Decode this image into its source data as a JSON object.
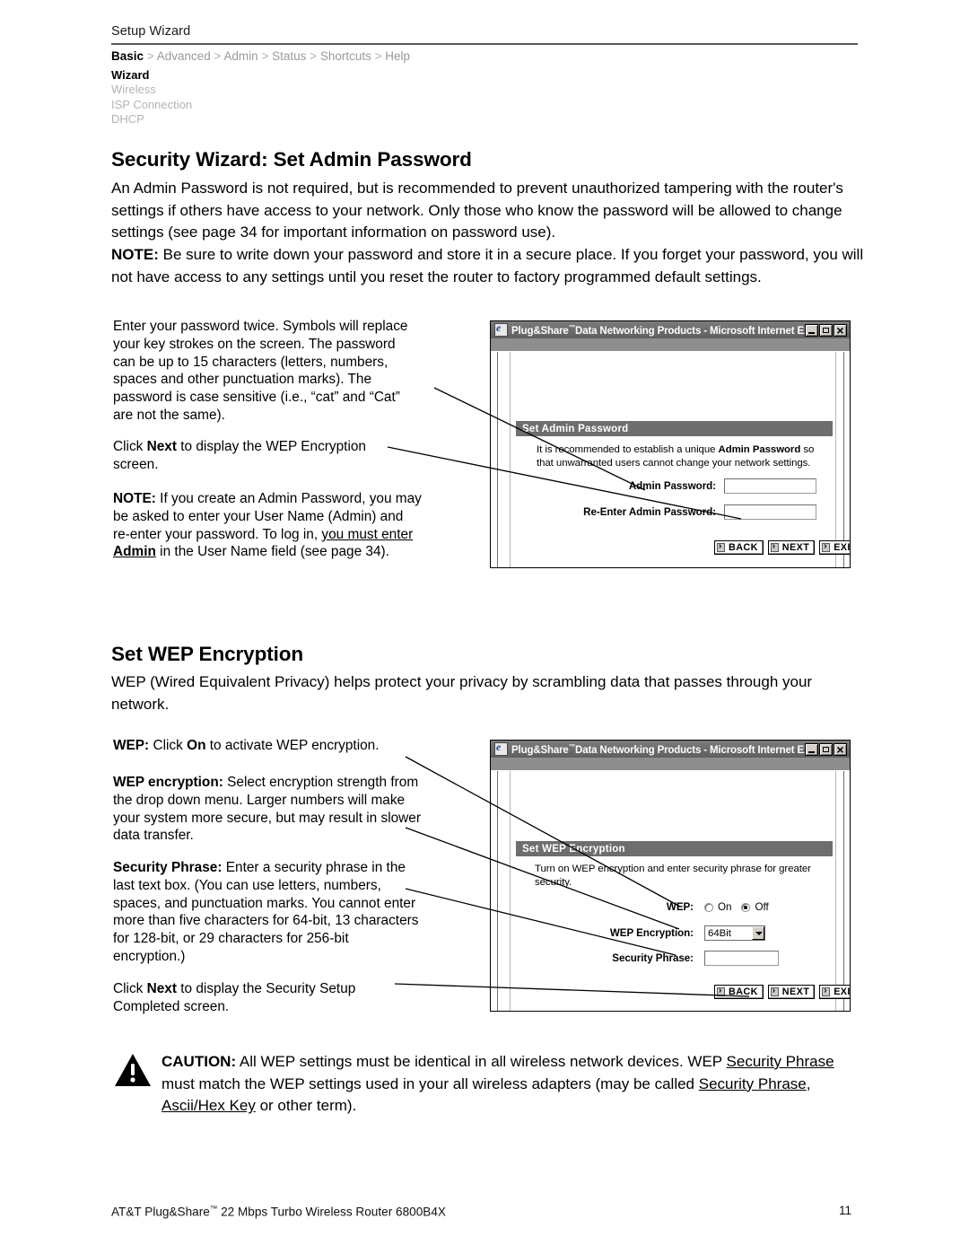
{
  "header": {
    "title": "Setup Wizard",
    "breadcrumb": [
      {
        "label": "Basic",
        "active": true
      },
      {
        "label": "Advanced",
        "active": false
      },
      {
        "label": "Admin",
        "active": false
      },
      {
        "label": "Status",
        "active": false
      },
      {
        "label": "Shortcuts",
        "active": false
      },
      {
        "label": "Help",
        "active": false
      }
    ],
    "breadcrumb_separator": ">",
    "subnav": [
      {
        "label": "Wizard",
        "active": true
      },
      {
        "label": "Wireless",
        "active": false
      },
      {
        "label": "ISP Connection",
        "active": false
      },
      {
        "label": "DHCP",
        "active": false
      }
    ]
  },
  "section1": {
    "heading": "Security Wizard: Set Admin Password",
    "para1": "An Admin Password is not required, but is recommended to prevent unauthorized tampering with the router's settings if others have access to your network. Only those who know the password will be allowed to change settings (see page 34 for important information on password use).",
    "note_label": "NOTE:",
    "note_text": " Be sure to write down your password and store it in a secure place. If you forget your password, you will not have access to any settings until you reset the router to factory programmed default settings.",
    "callouts": {
      "c1": "Enter your password twice. Symbols will replace your key strokes on the screen. The password can be up to 15 characters (letters, numbers, spaces and other punctuation marks). The password is case sensitive (i.e., “cat” and “Cat” are not the same).",
      "c2_pre": "Click ",
      "c2_bold": "Next",
      "c2_post": " to display the WEP Encryption screen.",
      "c3_label": "NOTE:",
      "c3_text_a": " If you create an Admin Password, you may be asked to enter your User Name (Admin) and re-enter your password. To log in, ",
      "c3_underline_a": "you must enter ",
      "c3_underline_bold": "Admin",
      "c3_text_b": " in the User Name field (see page 34)."
    }
  },
  "window1": {
    "title": "Plug&Share",
    "title_tm": "™",
    "title_rest": "Data Networking Products - Microsoft Internet Expl...",
    "panel_title": "Set Admin Password",
    "desc_pre": "It is recommended to establish a unique ",
    "desc_bold": "Admin Password",
    "desc_post": " so that unwarranted users cannot change your network settings.",
    "fields": [
      {
        "label": "Admin Password:",
        "value": ""
      },
      {
        "label": "Re-Enter Admin Password:",
        "value": ""
      }
    ],
    "buttons": [
      "BACK",
      "NEXT",
      "EXIT"
    ],
    "window_controls": [
      "minimize",
      "maximize",
      "close"
    ]
  },
  "section2": {
    "heading": "Set WEP Encryption",
    "para1": "WEP (Wired Equivalent Privacy) helps protect your privacy by scrambling data that passes through your network.",
    "callouts": {
      "c1_label": "WEP:",
      "c1_pre": " Click ",
      "c1_bold": "On",
      "c1_post": " to activate WEP encryption.",
      "c2_label": "WEP encryption:",
      "c2_text": " Select encryption strength from the drop down menu. Larger numbers will make your system more secure, but may result in slower data transfer.",
      "c3_label": "Security Phrase:",
      "c3_text": " Enter a security phrase in the last text box. (You can use letters, numbers, spaces, and punctuation marks. You cannot enter more than five characters for 64-bit, 13 characters for 128-bit, or 29 characters for 256-bit encryption.)",
      "c4_pre": "Click ",
      "c4_bold": "Next",
      "c4_post": " to display the Security Setup Completed screen."
    }
  },
  "window2": {
    "title": "Plug&Share",
    "title_tm": "™",
    "title_rest": "Data Networking Products - Microsoft Internet Expl...",
    "panel_title": "Set WEP Encryption",
    "desc": "Turn on WEP encryption and enter security phrase for greater security.",
    "wep_label": "WEP:",
    "wep_options": [
      {
        "label": "On",
        "selected": false
      },
      {
        "label": "Off",
        "selected": true
      }
    ],
    "encryption_label": "WEP Encryption:",
    "encryption_value": "64Bit",
    "phrase_label": "Security Phrase:",
    "phrase_value": "",
    "buttons": [
      "BACK",
      "NEXT",
      "EXIT"
    ],
    "window_controls": [
      "minimize",
      "maximize",
      "close"
    ]
  },
  "caution": {
    "label": "CAUTION:",
    "t1": " All WEP settings must be identical in all wireless network devices. WEP ",
    "u1": "Security Phrase",
    "t2": " must match the WEP settings used in your all wireless adapters (may be called ",
    "u2": "Security Phrase",
    "t3": ", ",
    "u3": "Ascii/Hex Key",
    "t4": " or other term)."
  },
  "footer": {
    "left": "AT&T Plug&Share",
    "left_tm": "™",
    "left_rest": " 22 Mbps Turbo Wireless Router 6800B4X",
    "page_number": "11"
  }
}
